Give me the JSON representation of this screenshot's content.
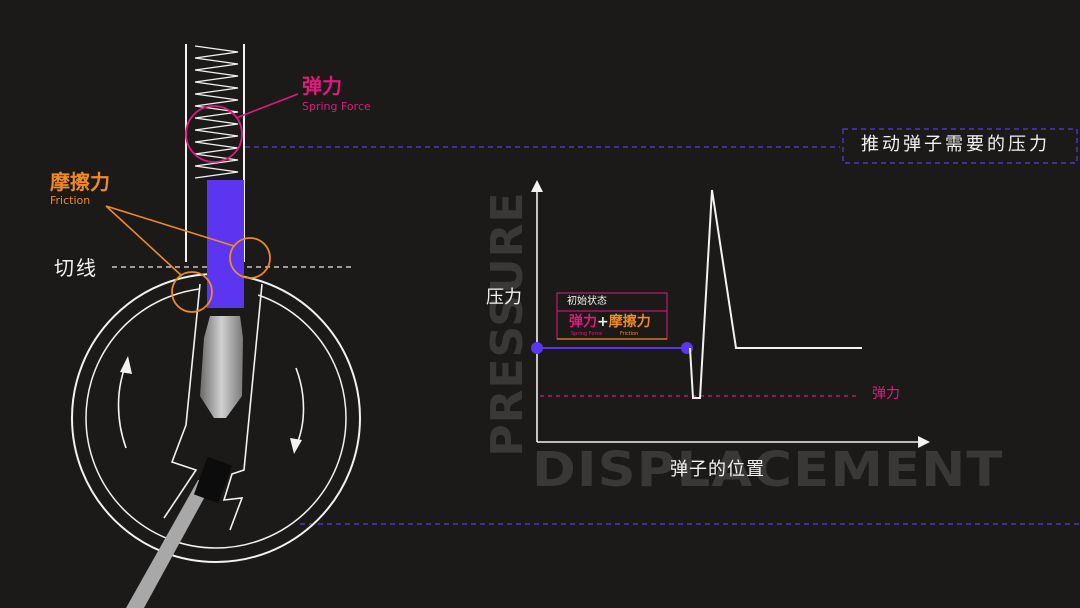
{
  "colors": {
    "background": "#1b1a19",
    "magenta": "#e0197d",
    "orange": "#f08a24",
    "purple": "#5b35f0",
    "white": "#f2f2f2",
    "dashed_purple": "#5a3be0",
    "watermark": "#3a3836"
  },
  "labels": {
    "spring_cn": "弹力",
    "spring_en": "Spring Force",
    "friction_cn": "摩擦力",
    "friction_en": "Friction",
    "tangent": "切线",
    "push_pressure": "推动弹子需要的压力",
    "pressure_cn": "压力",
    "displacement_cn": "弹子的位置",
    "spring_line": "弹力",
    "watermark_y": "PRESSURE",
    "watermark_x": "DISPLACEMENT"
  },
  "legend": {
    "title": "初始状态",
    "spring_cn": "弹力",
    "plus": "+",
    "friction_cn": "摩擦力",
    "spring_en": "Spring Force",
    "friction_en": "Friction"
  },
  "icons": [
    "spring-coil-icon",
    "rotation-arrow-icon",
    "tension-tool-icon"
  ]
}
